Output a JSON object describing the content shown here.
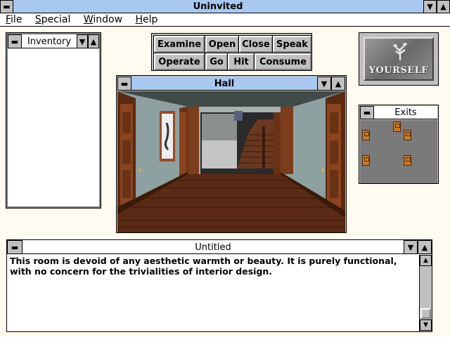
{
  "app": {
    "title": "Uninvited"
  },
  "menu": {
    "items": [
      "File",
      "Special",
      "Window",
      "Help"
    ],
    "mnemonics": [
      "F",
      "S",
      "W",
      "H"
    ]
  },
  "inventory": {
    "title": "Inventory"
  },
  "commands": [
    "Examine",
    "Open",
    "Close",
    "Speak",
    "Operate",
    "Go",
    "Hit",
    "Consume"
  ],
  "yourself": {
    "label": "YOURSELF"
  },
  "scene": {
    "title": "Hall"
  },
  "exits": {
    "title": "Exits"
  },
  "text_window": {
    "title": "Untitled",
    "body": "This room is devoid of any aesthetic warmth or beauty.  It is purely functional, with no concern for the trivialities of interior design."
  },
  "icons": {
    "system": "minus-box",
    "down": "down-triangle",
    "up": "up-triangle"
  }
}
